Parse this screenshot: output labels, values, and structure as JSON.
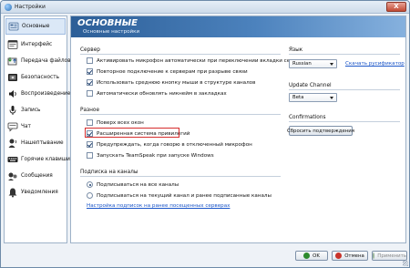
{
  "window": {
    "title": "Настройки",
    "close_glyph": "X"
  },
  "sidebar": {
    "items": [
      {
        "label": "Основные",
        "icon": "general-icon",
        "active": true
      },
      {
        "label": "Интерфейс",
        "icon": "interface-icon"
      },
      {
        "label": "Передача файлов",
        "icon": "file-transfer-icon"
      },
      {
        "label": "Безопасность",
        "icon": "security-icon"
      },
      {
        "label": "Воспроизведение",
        "icon": "playback-icon"
      },
      {
        "label": "Запись",
        "icon": "record-icon"
      },
      {
        "label": "Чат",
        "icon": "chat-icon"
      },
      {
        "label": "Нашептывание",
        "icon": "whisper-icon"
      },
      {
        "label": "Горячие клавиши",
        "icon": "hotkeys-icon"
      },
      {
        "label": "Сообщения",
        "icon": "messages-icon"
      },
      {
        "label": "Уведомления",
        "icon": "notifications-icon"
      }
    ]
  },
  "header": {
    "title": "ОСНОВНЫЕ",
    "subtitle": "Основные настройки"
  },
  "server": {
    "title": "Сервер",
    "options": [
      {
        "label": "Активировать микрофон автоматически при переключении вкладки сервера",
        "checked": false
      },
      {
        "label": "Повторное подключение к серверам при разрыве связи",
        "checked": true
      },
      {
        "label": "Использовать среднюю кнопку мыши в структуре каналов",
        "checked": true
      },
      {
        "label": "Автоматически обновлять никнейм в закладках",
        "checked": false
      }
    ]
  },
  "misc": {
    "title": "Разное",
    "options": [
      {
        "label": "Поверх всех окон",
        "checked": false
      },
      {
        "label": "Расширенная система привилегий",
        "checked": true
      },
      {
        "label": "Предупреждать, когда говорю в отключенный микрофон",
        "checked": true
      },
      {
        "label": "Запускать TeamSpeak при запуске Windows",
        "checked": false
      }
    ]
  },
  "subscribe": {
    "title": "Подписка на каналы",
    "options": [
      {
        "label": "Подписываться на все каналы",
        "checked": true
      },
      {
        "label": "Подписываться на текущий канал и ранее подписанные каналы",
        "checked": false
      }
    ],
    "link": "Настройка подписок на ранее посещенных серверах"
  },
  "language": {
    "title": "Язык",
    "value": "Russian",
    "link": "Скачать русификатор"
  },
  "update": {
    "title": "Update Channel",
    "value": "Beta"
  },
  "confirmations": {
    "title": "Confirmations",
    "button": "Сбросить подтверждения"
  },
  "footer": {
    "ok": "OK",
    "cancel": "Отмена",
    "apply": "Применить"
  },
  "colors": {
    "header_start": "#2c5e97",
    "header_end": "#86b1de",
    "highlight": "#d62d2d",
    "link": "#1a55c8"
  }
}
